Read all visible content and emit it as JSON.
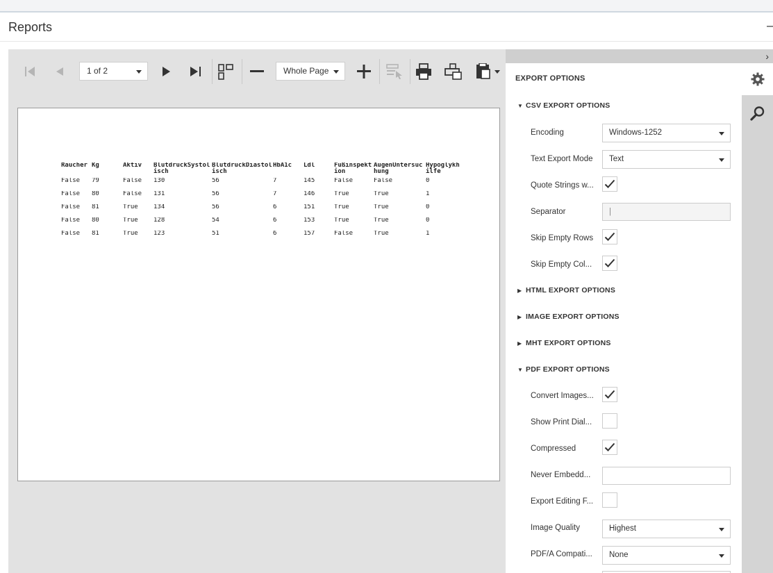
{
  "panel": {
    "title": "Reports"
  },
  "toolbar": {
    "page_selector": "1 of 2",
    "zoom": "Whole Page"
  },
  "report": {
    "headers": [
      "Raucher",
      "Kg",
      "Aktiv",
      "BlutdruckSystolisch",
      "BlutdruckDiastolisch",
      "HbA1c",
      "Ldl",
      "Fußinspektion",
      "AugenUntersuchung",
      "Hypoglykhilfe"
    ],
    "rows": [
      [
        "False",
        "79",
        "False",
        "130",
        "56",
        "7",
        "145",
        "False",
        "False",
        "0"
      ],
      [
        "False",
        "80",
        "False",
        "131",
        "56",
        "7",
        "146",
        "True",
        "True",
        "1"
      ],
      [
        "False",
        "81",
        "True",
        "134",
        "56",
        "6",
        "151",
        "True",
        "True",
        "0"
      ],
      [
        "False",
        "80",
        "True",
        "128",
        "54",
        "6",
        "153",
        "True",
        "True",
        "0"
      ],
      [
        "False",
        "81",
        "True",
        "123",
        "51",
        "6",
        "157",
        "False",
        "True",
        "1"
      ]
    ]
  },
  "export": {
    "title": "EXPORT OPTIONS",
    "csv": {
      "title": "CSV EXPORT OPTIONS",
      "encoding_label": "Encoding",
      "encoding_value": "Windows-1252",
      "text_mode_label": "Text Export Mode",
      "text_mode_value": "Text",
      "quote_label": "Quote Strings w...",
      "quote_checked": true,
      "separator_label": "Separator",
      "separator_value": "|",
      "skip_rows_label": "Skip Empty Rows",
      "skip_rows_checked": true,
      "skip_cols_label": "Skip Empty Col...",
      "skip_cols_checked": true
    },
    "html_title": "HTML EXPORT OPTIONS",
    "image_title": "IMAGE EXPORT OPTIONS",
    "mht_title": "MHT EXPORT OPTIONS",
    "pdf": {
      "title": "PDF EXPORT OPTIONS",
      "convert_label": "Convert Images...",
      "convert_checked": true,
      "print_dialog_label": "Show Print Dial...",
      "print_dialog_checked": false,
      "compressed_label": "Compressed",
      "compressed_checked": true,
      "never_embed_label": "Never Embedd...",
      "never_embed_value": "",
      "export_editing_label": "Export Editing F...",
      "export_editing_checked": false,
      "image_quality_label": "Image Quality",
      "image_quality_value": "Highest",
      "pdfa_label": "PDF/A Compati...",
      "pdfa_value": "None"
    }
  }
}
